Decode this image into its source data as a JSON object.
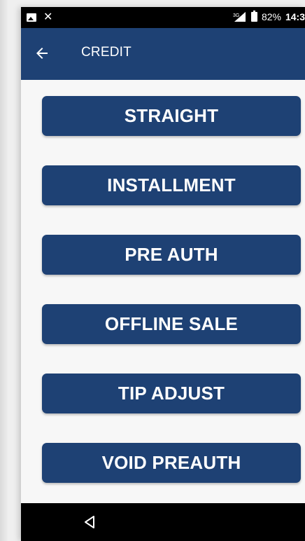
{
  "status_bar": {
    "network_label": "3G",
    "battery": "82%",
    "time": "14:3"
  },
  "app_bar": {
    "title": "CREDIT"
  },
  "menu": {
    "items": [
      {
        "label": "STRAIGHT"
      },
      {
        "label": "INSTALLMENT"
      },
      {
        "label": "PRE AUTH"
      },
      {
        "label": "OFFLINE SALE"
      },
      {
        "label": "TIP ADJUST"
      },
      {
        "label": "VOID PREAUTH"
      }
    ]
  },
  "colors": {
    "primary": "#1e4174",
    "background": "#f7f7f7",
    "status_bar": "#000000"
  },
  "icons": {
    "status_left": [
      "image-notification-icon",
      "missed-call-icon"
    ],
    "app_bar": "back-arrow-icon",
    "nav_bar": "nav-back-triangle-icon"
  }
}
